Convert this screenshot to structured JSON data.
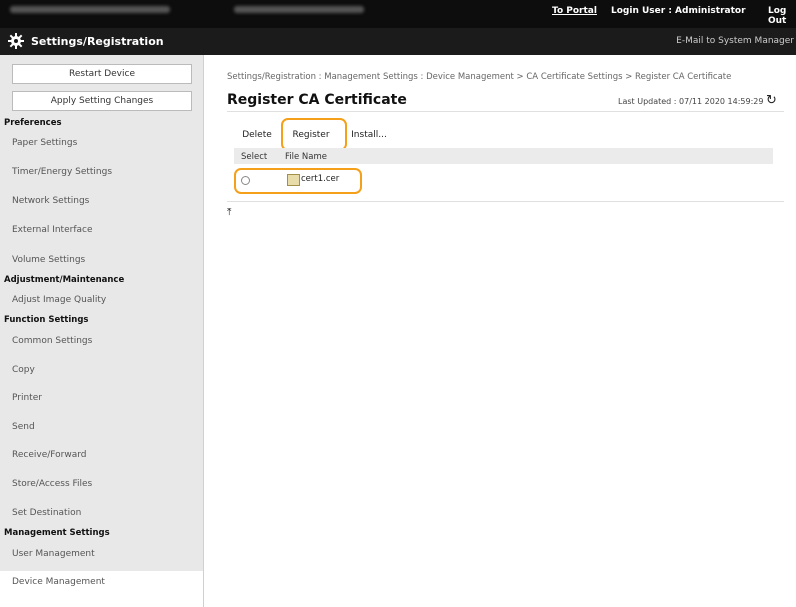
{
  "topbar": {
    "to_portal": "To Portal",
    "login_user": "Login User : Administrator",
    "logout": "Log Out"
  },
  "header": {
    "title": "Settings/Registration",
    "mail": "E-Mail to System Manager"
  },
  "sidebar": {
    "restart": "Restart Device",
    "apply": "Apply Setting Changes",
    "sections": {
      "preferences": "Preferences",
      "adjustment": "Adjustment/Maintenance",
      "function": "Function Settings",
      "management": "Management Settings"
    },
    "items": {
      "paper": "Paper Settings",
      "timer": "Timer/Energy Settings",
      "network": "Network Settings",
      "external": "External Interface",
      "volume": "Volume Settings",
      "adjust_image": "Adjust Image Quality",
      "common": "Common Settings",
      "copy": "Copy",
      "printer": "Printer",
      "send": "Send",
      "receive": "Receive/Forward",
      "store": "Store/Access Files",
      "destination": "Set Destination",
      "user_mgmt": "User Management",
      "device_mgmt": "Device Management"
    }
  },
  "main": {
    "breadcrumb": "Settings/Registration : Management Settings : Device Management > CA Certificate Settings > Register CA Certificate",
    "title": "Register CA Certificate",
    "last_updated": "Last Updated : 07/11 2020 14:59:29",
    "buttons": {
      "delete": "Delete",
      "register": "Register",
      "install": "Install..."
    },
    "table": {
      "col_select": "Select",
      "col_file": "File Name",
      "rows": [
        {
          "file": "cert1.cer"
        }
      ]
    }
  },
  "colors": {
    "highlight": "#f5a01a",
    "topbar": "#0d0d0d",
    "header": "#1b1b1b"
  }
}
